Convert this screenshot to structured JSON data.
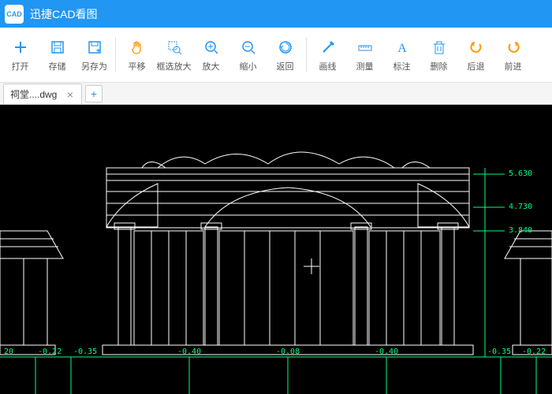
{
  "app": {
    "title": "迅捷CAD看图",
    "logo_text": "CAD"
  },
  "toolbar": {
    "groups": [
      {
        "items": [
          {
            "name": "open-button",
            "icon": "plus",
            "label": "打开"
          },
          {
            "name": "save-button",
            "icon": "save",
            "label": "存储"
          },
          {
            "name": "saveas-button",
            "icon": "saveas",
            "label": "另存为"
          }
        ]
      },
      {
        "items": [
          {
            "name": "pan-button",
            "icon": "hand",
            "label": "平移"
          },
          {
            "name": "zoom-window-button",
            "icon": "zoomwin",
            "label": "框选放大"
          },
          {
            "name": "zoom-in-button",
            "icon": "zoomin",
            "label": "放大"
          },
          {
            "name": "zoom-out-button",
            "icon": "zoomout",
            "label": "缩小"
          },
          {
            "name": "return-button",
            "icon": "return",
            "label": "返回"
          }
        ]
      },
      {
        "items": [
          {
            "name": "line-button",
            "icon": "line",
            "label": "画线"
          },
          {
            "name": "measure-button",
            "icon": "measure",
            "label": "测量"
          },
          {
            "name": "text-button",
            "icon": "text",
            "label": "标注"
          },
          {
            "name": "delete-button",
            "icon": "trash",
            "label": "删除"
          },
          {
            "name": "undo-button",
            "icon": "undo",
            "label": "后退"
          },
          {
            "name": "redo-button",
            "icon": "redo",
            "label": "前进"
          }
        ]
      }
    ]
  },
  "tabs": {
    "file": "祠堂....dwg"
  },
  "drawing": {
    "elevations": {
      "e1": "5.630",
      "e2": "4.730",
      "e3": "3.840"
    },
    "ground": {
      "g1": "20",
      "g2": "-0.22",
      "g3": "-0.35",
      "g4": "-0.40",
      "g5": "-0.08",
      "g6": "-0.40",
      "g7": "-0.35",
      "g8": "-0.22"
    }
  }
}
